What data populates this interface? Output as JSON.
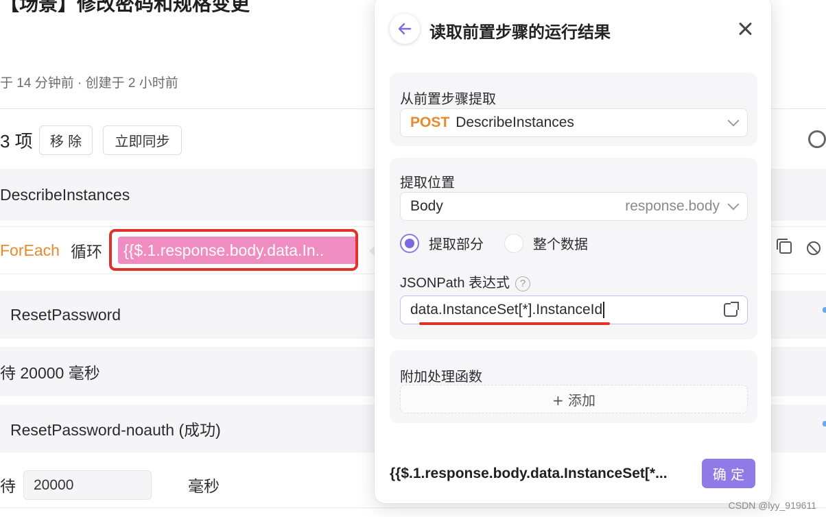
{
  "background": {
    "title": "【场景】修改密码和规格变更",
    "meta": "于 14 分钟前 · 创建于 2 小时前",
    "toolbar": {
      "count": "3 项",
      "remove_label": "移 除",
      "sync_label": "立即同步"
    },
    "rows": {
      "describe": "DescribeInstances",
      "foreach_keyword": "ForEach",
      "foreach_loop": "循环",
      "foreach_expr": "{{$.1.response.body.data.In..",
      "reset_password": "ResetPassword",
      "wait1": "待 20000 毫秒",
      "reset_noauth": "ResetPassword-noauth (成功)",
      "wait2_prefix": "待",
      "wait2_value": "20000",
      "wait2_unit": "毫秒"
    }
  },
  "panel": {
    "title": "读取前置步骤的运行结果",
    "source": {
      "label": "从前置步骤提取",
      "method": "POST",
      "step": "DescribeInstances"
    },
    "location": {
      "label": "提取位置",
      "value": "Body",
      "hint": "response.body",
      "options": [
        {
          "label": "提取部分",
          "checked": true
        },
        {
          "label": "整个数据",
          "checked": false
        }
      ]
    },
    "jsonpath": {
      "label": "JSONPath 表达式",
      "help": "?",
      "value": "data.InstanceSet[*].InstanceId"
    },
    "process": {
      "label": "附加处理函数",
      "add_label": "+ 添加"
    },
    "result": "{{$.1.response.body.data.InstanceSet[*...",
    "confirm_label": "确 定"
  },
  "watermark": "CSDN @lyy_919611",
  "colors": {
    "accent": "#8f7ae6",
    "method": "#e8892b",
    "highlight": "#ef8cc0",
    "annotation": "#e0322a"
  }
}
